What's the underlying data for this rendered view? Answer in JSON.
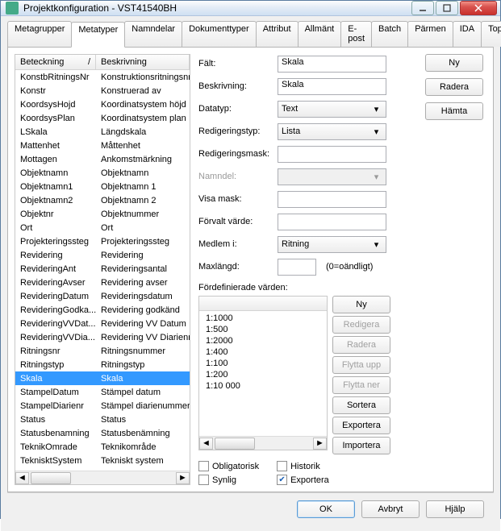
{
  "window": {
    "title": "Projektkonfiguration - VST41540BH"
  },
  "tabs": [
    "Metagrupper",
    "Metatyper",
    "Namndelar",
    "Dokumenttyper",
    "Attribut",
    "Allmänt",
    "E-post",
    "Batch",
    "Pärmen",
    "IDA",
    "Topocad"
  ],
  "activeTab": 1,
  "list": {
    "header": {
      "col1": "Beteckning",
      "col2": "Beskrivning"
    },
    "rows": [
      {
        "c1": "KonstbRitningsNr",
        "c2": "Konstruktionsritningsnr"
      },
      {
        "c1": "Konstr",
        "c2": "Konstruerad av"
      },
      {
        "c1": "KoordsysHojd",
        "c2": "Koordinatsystem höjd"
      },
      {
        "c1": "KoordsysPlan",
        "c2": "Koordinatsystem plan"
      },
      {
        "c1": "LSkala",
        "c2": "Längdskala"
      },
      {
        "c1": "Mattenhet",
        "c2": "Måttenhet"
      },
      {
        "c1": "Mottagen",
        "c2": "Ankomstmärkning"
      },
      {
        "c1": "Objektnamn",
        "c2": "Objektnamn"
      },
      {
        "c1": "Objektnamn1",
        "c2": "Objektnamn 1"
      },
      {
        "c1": "Objektnamn2",
        "c2": "Objektnamn 2"
      },
      {
        "c1": "Objektnr",
        "c2": "Objektnummer"
      },
      {
        "c1": "Ort",
        "c2": "Ort"
      },
      {
        "c1": "Projekteringssteg",
        "c2": "Projekteringssteg"
      },
      {
        "c1": "Revidering",
        "c2": "Revidering"
      },
      {
        "c1": "RevideringAnt",
        "c2": "Revideringsantal"
      },
      {
        "c1": "RevideringAvser",
        "c2": "Revidering avser"
      },
      {
        "c1": "RevideringDatum",
        "c2": "Revideringsdatum"
      },
      {
        "c1": "RevideringGodka...",
        "c2": "Revidering godkänd"
      },
      {
        "c1": "RevideringVVDat...",
        "c2": "Revidering VV Datum"
      },
      {
        "c1": "RevideringVVDia...",
        "c2": "Revidering VV Diarienr"
      },
      {
        "c1": "Ritningsnr",
        "c2": "Ritningsnummer"
      },
      {
        "c1": "Ritningstyp",
        "c2": "Ritningstyp"
      },
      {
        "c1": "Skala",
        "c2": "Skala",
        "selected": true
      },
      {
        "c1": "StampelDatum",
        "c2": "Stämpel datum"
      },
      {
        "c1": "StampelDiarienr",
        "c2": "Stämpel diarienummer"
      },
      {
        "c1": "Status",
        "c2": "Status"
      },
      {
        "c1": "Statusbenamning",
        "c2": "Statusbenämning"
      },
      {
        "c1": "TeknikOmrade",
        "c2": "Teknikområde"
      },
      {
        "c1": "TeknisktSystem",
        "c2": "Tekniskt system"
      }
    ]
  },
  "form": {
    "falt_label": "Fält:",
    "falt": "Skala",
    "beskrivning_label": "Beskrivning:",
    "beskrivning": "Skala",
    "datatyp_label": "Datatyp:",
    "datatyp": "Text",
    "redigeringstyp_label": "Redigeringstyp:",
    "redigeringstyp": "Lista",
    "redigeringsmask_label": "Redigeringsmask:",
    "redigeringsmask": "",
    "namndel_label": "Namndel:",
    "namndel": "",
    "visamask_label": "Visa mask:",
    "visamask": "",
    "forvalt_label": "Förvalt värde:",
    "forvalt": "",
    "medlemi_label": "Medlem i:",
    "medlemi": "Ritning",
    "maxlangd_label": "Maxlängd:",
    "maxlangd": "",
    "maxlangd_hint": "(0=oändligt)",
    "predef_label": "Fördefinierade värden:",
    "predef_items": [
      "1:1000",
      "1:500",
      "1:2000",
      "1:400",
      "1:100",
      "1:200",
      "1:10 000"
    ],
    "valbtns": {
      "ny": "Ny",
      "redigera": "Redigera",
      "radera": "Radera",
      "flytta_upp": "Flytta upp",
      "flytta_ner": "Flytta ner",
      "sortera": "Sortera",
      "exportera": "Exportera",
      "importera": "Importera"
    },
    "checks": {
      "obligatorisk": "Obligatorisk",
      "synlig": "Synlig",
      "historik": "Historik",
      "exportera": "Exportera"
    }
  },
  "sidebtns": {
    "ny": "Ny",
    "radera": "Radera",
    "hamta": "Hämta"
  },
  "footer": {
    "ok": "OK",
    "avbryt": "Avbryt",
    "hjalp": "Hjälp"
  }
}
